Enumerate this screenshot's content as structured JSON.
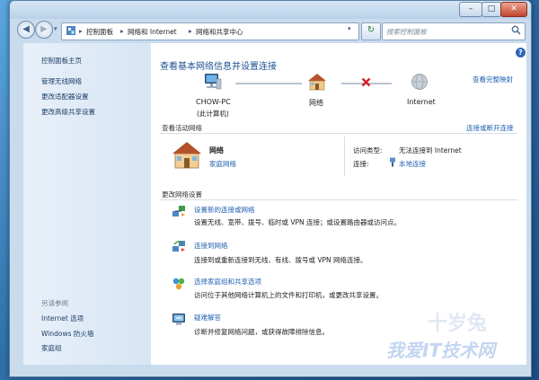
{
  "window": {
    "controls": {
      "minimize": "–",
      "maximize": "□",
      "close": "✕"
    }
  },
  "toolbar": {
    "back": "◀",
    "forward": "▶",
    "breadcrumb": [
      "控制面板",
      "网络和 Internet",
      "网络和共享中心"
    ],
    "separator": "▸",
    "search_placeholder": "搜索控制面板",
    "refresh": "↻"
  },
  "sidebar": {
    "top_links": [
      "控制面板主页",
      "管理无线网络",
      "更改适配器设置",
      "更改高级共享设置"
    ],
    "see_also_label": "另请参阅",
    "see_also_links": [
      "Internet 选项",
      "Windows 防火墙",
      "家庭组"
    ]
  },
  "main": {
    "title": "查看基本网络信息并设置连接",
    "full_map_link": "查看完整映射",
    "map": {
      "computer_name": "CHOW-PC",
      "computer_sub": "(此计算机)",
      "network_label": "网络",
      "internet_label": "Internet"
    },
    "active": {
      "header": "查看活动网络",
      "connect_link": "连接或断开连接",
      "network_name": "网络",
      "network_type": "家庭网络",
      "access_type_label": "访问类型:",
      "access_type_value": "无法连接到 Internet",
      "connections_label": "连接:",
      "connections_value": "本地连接"
    },
    "change": {
      "header": "更改网络设置",
      "tasks": [
        {
          "title": "设置新的连接或网络",
          "desc": "设置无线、宽带、拨号、临时或 VPN 连接；或设置路由器或访问点。"
        },
        {
          "title": "连接到网络",
          "desc": "连接到或重新连接到无线、有线、拨号或 VPN 网络连接。"
        },
        {
          "title": "选择家庭组和共享选项",
          "desc": "访问位于其他网络计算机上的文件和打印机，或更改共享设置。"
        },
        {
          "title": "疑难解答",
          "desc": "诊断并修复网络问题，或获得故障排除信息。"
        }
      ]
    }
  },
  "watermark": {
    "main": "我爱IT技术网",
    "corner": "十岁兔"
  },
  "colors": {
    "link": "#1f5fb0",
    "title": "#1d4f92",
    "error_x": "#d8232a"
  }
}
